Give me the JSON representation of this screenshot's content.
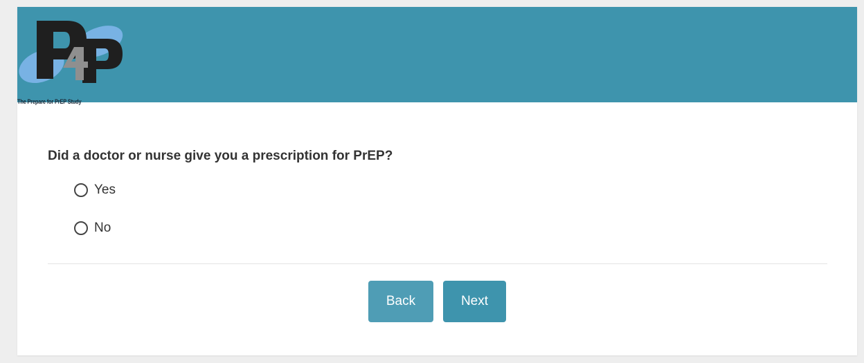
{
  "header": {
    "logo_text": "P4P",
    "logo_tagline": "The Prepare for PrEP Study",
    "background_color": "#3e94ad"
  },
  "question": {
    "text": "Did a doctor or nurse give you a prescription for PrEP?",
    "options": [
      {
        "label": "Yes",
        "selected": false
      },
      {
        "label": "No",
        "selected": false
      }
    ]
  },
  "navigation": {
    "back_label": "Back",
    "next_label": "Next",
    "back_color": "#4f9db5",
    "next_color": "#3e94ad"
  }
}
